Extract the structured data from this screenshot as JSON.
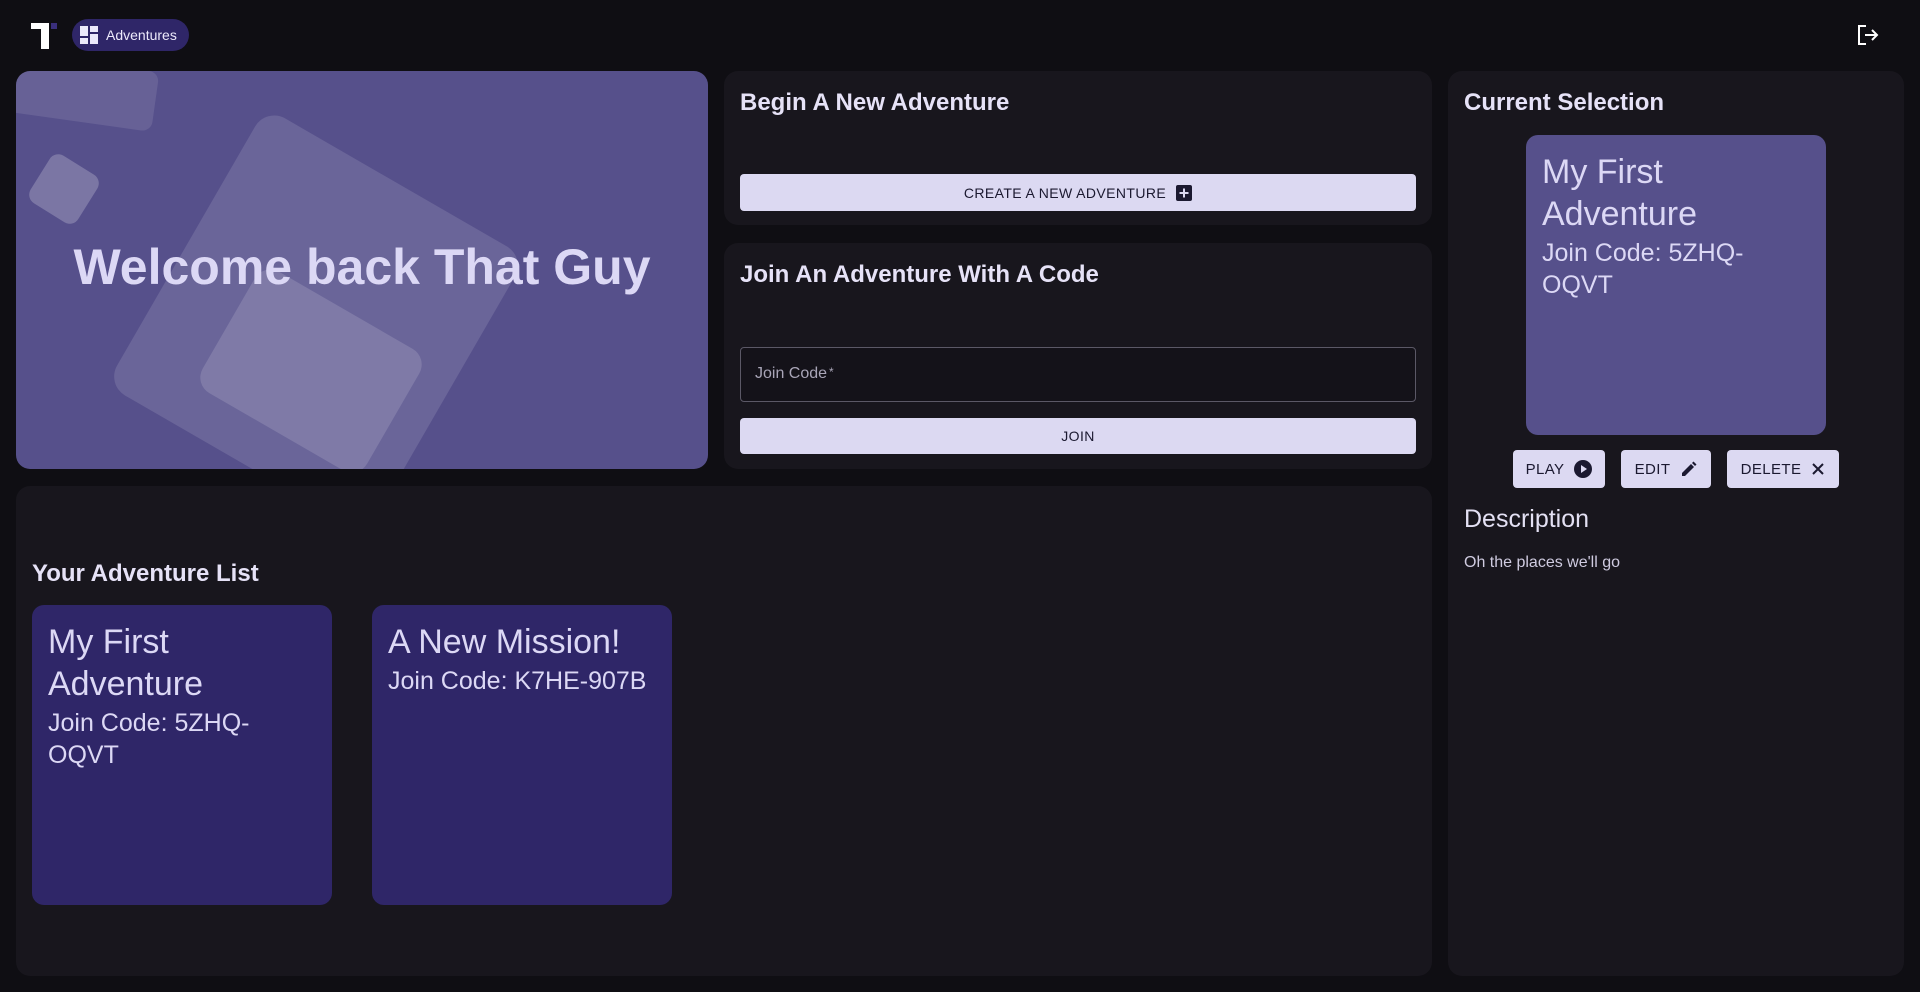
{
  "nav": {
    "chip_label": "Adventures"
  },
  "hero": {
    "welcome": "Welcome back That Guy"
  },
  "create": {
    "title": "Begin A New Adventure",
    "button_label": "CREATE A NEW ADVENTURE"
  },
  "join": {
    "title": "Join An Adventure With A Code",
    "input_label": "Join Code",
    "required_mark": "*",
    "input_value": "",
    "button_label": "JOIN"
  },
  "list": {
    "title": "Your Adventure List",
    "items": [
      {
        "name": "My First Adventure",
        "code": "Join Code: 5ZHQ-OQVT"
      },
      {
        "name": "A New Mission!",
        "code": "Join Code: K7HE-907B"
      }
    ]
  },
  "selection": {
    "title": "Current Selection",
    "name": "My First Adventure",
    "code": "Join Code: 5ZHQ-OQVT",
    "actions": {
      "play": "PLAY",
      "edit": "EDIT",
      "delete": "DELETE"
    },
    "description_title": "Description",
    "description_text": "Oh the places we'll go"
  },
  "colors": {
    "background": "#0f0e13",
    "panel": "#18161d",
    "accent_dark": "#2f2668",
    "accent_light": "#56508b",
    "button_light": "#dcd9f2"
  },
  "icons": {
    "logo": "logo-icon",
    "nav": "dashboard-icon",
    "logout": "logout-icon",
    "create": "add-box-icon",
    "play": "play-circle-icon",
    "edit": "pencil-icon",
    "delete": "close-icon"
  }
}
